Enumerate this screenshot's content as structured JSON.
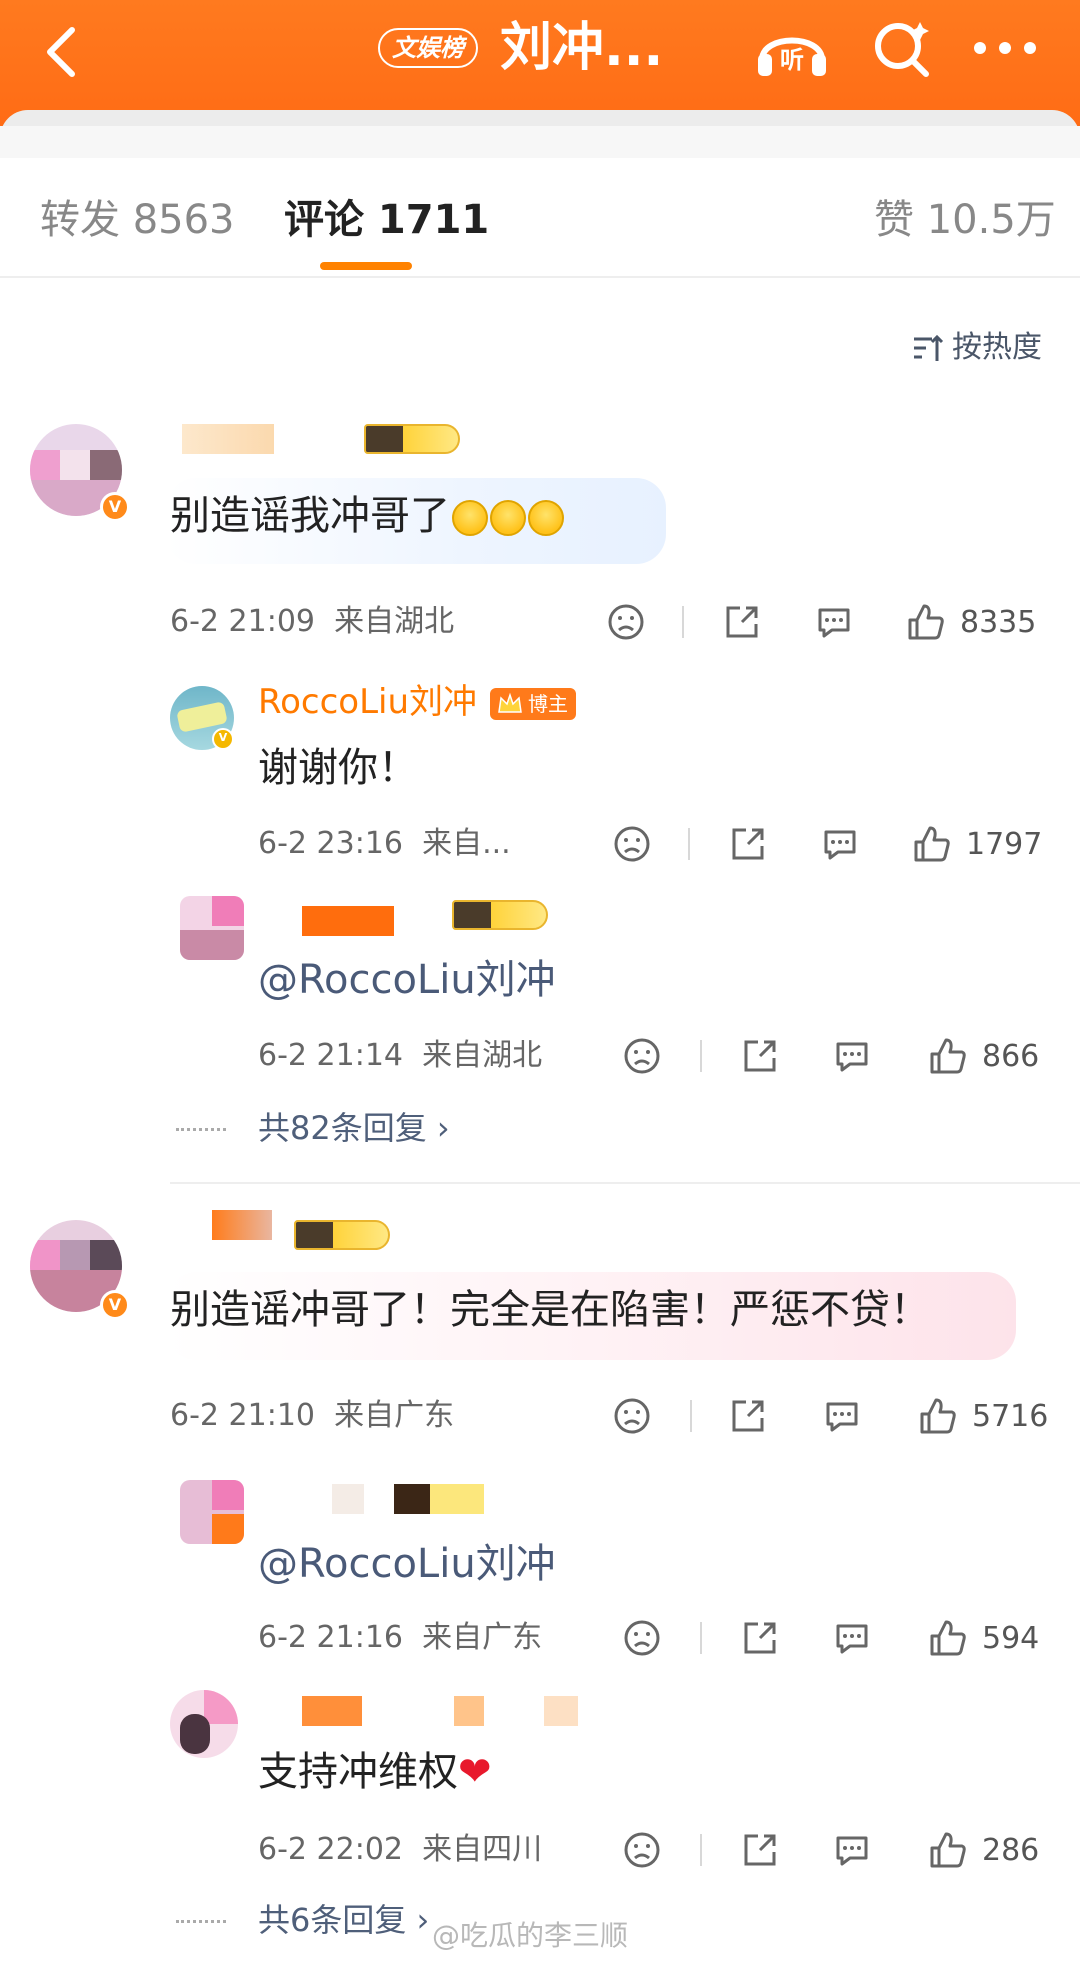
{
  "header": {
    "topic_pill": "文娱榜",
    "title": "刘冲...",
    "listen_label": "听"
  },
  "tabs": [
    {
      "label": "转发 8563"
    },
    {
      "label": "评论 1711"
    },
    {
      "label": "赞 10.5万"
    }
  ],
  "sort_label": "按热度",
  "comments": [
    {
      "text": "别造谣我冲哥了",
      "emojis": [
        "crying-emoji",
        "crying-emoji",
        "crying-emoji"
      ],
      "time": "6-2 21:09",
      "location": "来自湖北",
      "likes": "8335",
      "replies": [
        {
          "user": "RoccoLiu刘冲",
          "badge": "博主",
          "text": "谢谢你！",
          "time": "6-2 23:16",
          "location": "来自...",
          "likes": "1797"
        },
        {
          "text": "@RoccoLiu刘冲",
          "time": "6-2 21:14",
          "location": "来自湖北",
          "likes": "866"
        }
      ],
      "more_replies": "共82条回复"
    },
    {
      "text": "别造谣冲哥了！完全是在陷害！严惩不贷！",
      "time": "6-2 21:10",
      "location": "来自广东",
      "likes": "5716",
      "replies": [
        {
          "text": "@RoccoLiu刘冲",
          "time": "6-2 21:16",
          "location": "来自广东",
          "likes": "594"
        },
        {
          "text": "支持冲维权",
          "time": "6-2 22:02",
          "location": "来自四川",
          "likes": "286"
        }
      ],
      "more_replies": "共6条回复"
    }
  ],
  "watermark": "@吃瓜的李三顺",
  "colors": {
    "brand_orange": "#ff7a1f",
    "accent_underline": "#ff8200",
    "link_blue": "#4f5f7a"
  }
}
